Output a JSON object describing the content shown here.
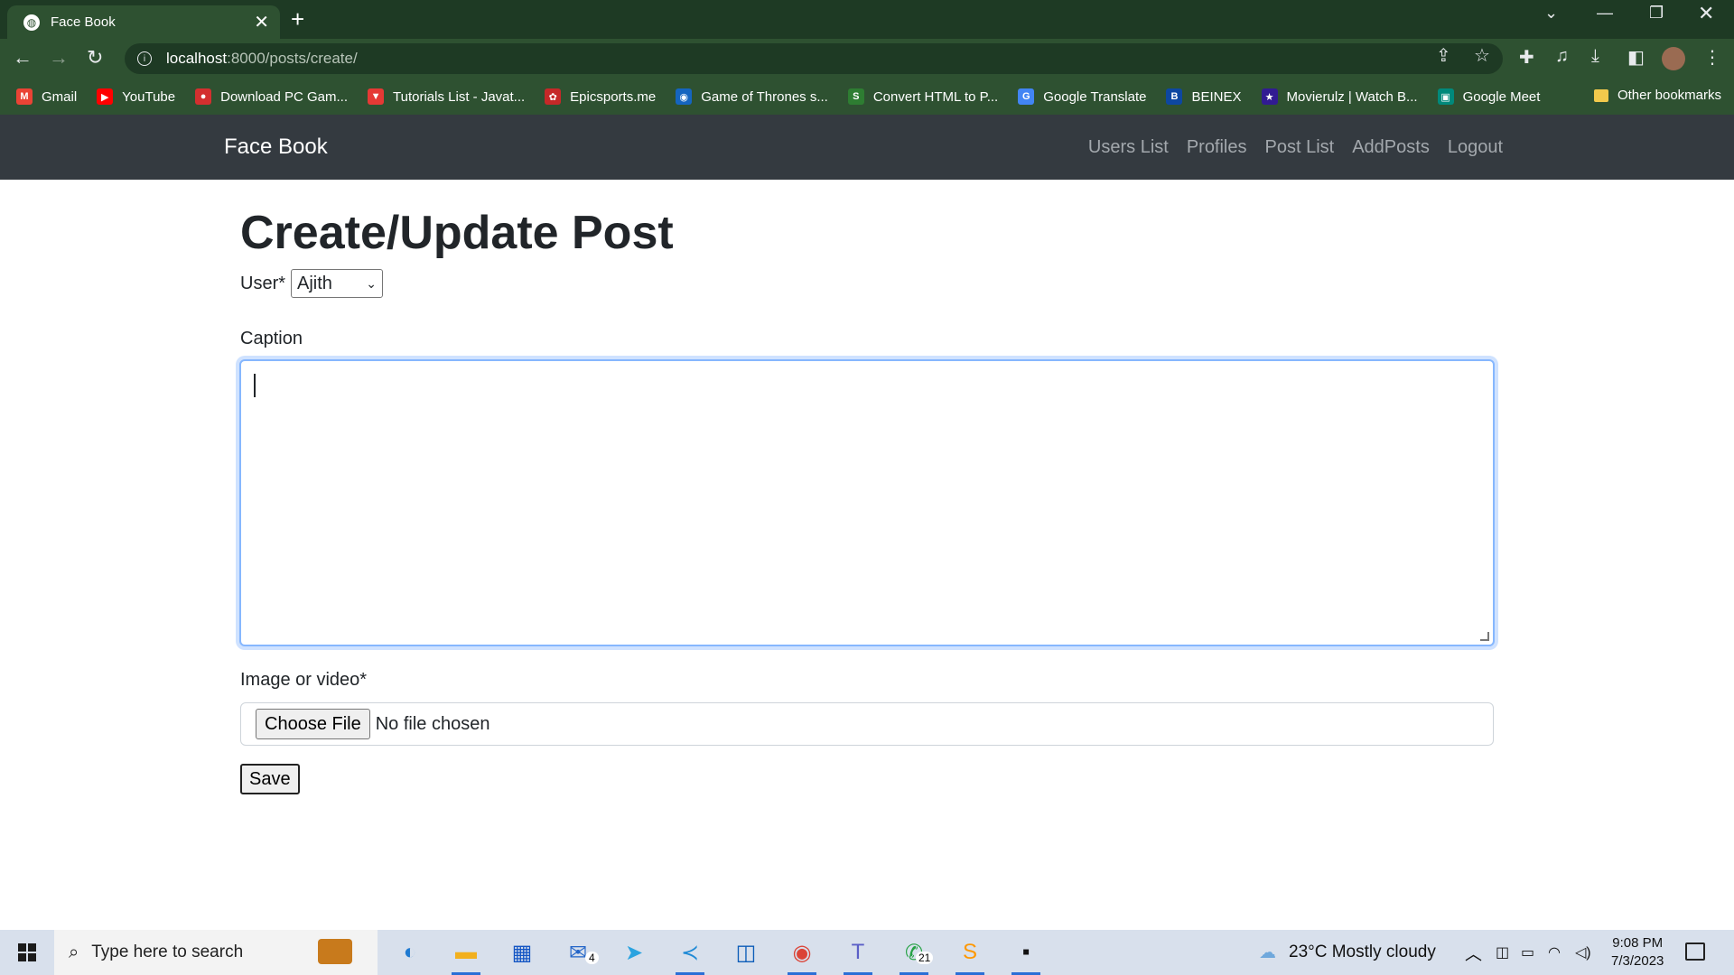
{
  "browser": {
    "tab_title": "Face Book",
    "tab_close": "✕",
    "new_tab": "+",
    "url_host": "localhost",
    "url_path": ":8000/posts/create/",
    "bookmarks": [
      {
        "label": "Gmail",
        "icon": "gmail-icon",
        "color": "#ea4335",
        "glyph": "M"
      },
      {
        "label": "YouTube",
        "icon": "youtube-icon",
        "color": "#ff0000",
        "glyph": "▶"
      },
      {
        "label": "Download PC Gam...",
        "icon": "game-icon",
        "color": "#d32f2f",
        "glyph": "●"
      },
      {
        "label": "Tutorials List - Javat...",
        "icon": "tutorial-icon",
        "color": "#e53935",
        "glyph": "▼"
      },
      {
        "label": "Epicsports.me",
        "icon": "sports-icon",
        "color": "#c62828",
        "glyph": "✿"
      },
      {
        "label": "Game of Thrones s...",
        "icon": "globe-icon",
        "color": "#1565c0",
        "glyph": "◉"
      },
      {
        "label": "Convert HTML to P...",
        "icon": "convert-icon",
        "color": "#2e7d32",
        "glyph": "S"
      },
      {
        "label": "Google Translate",
        "icon": "translate-icon",
        "color": "#4285f4",
        "glyph": "G"
      },
      {
        "label": "BEINEX",
        "icon": "beinex-icon",
        "color": "#0d47a1",
        "glyph": "B"
      },
      {
        "label": "Movierulz | Watch B...",
        "icon": "movie-icon",
        "color": "#311b92",
        "glyph": "★"
      },
      {
        "label": "Google Meet",
        "icon": "meet-icon",
        "color": "#00897b",
        "glyph": "▣"
      }
    ],
    "other_bookmarks": "Other bookmarks"
  },
  "navbar": {
    "brand": "Face Book",
    "links": [
      "Users List",
      "Profiles",
      "Post List",
      "AddPosts",
      "Logout"
    ]
  },
  "form": {
    "title": "Create/Update Post",
    "user_label": "User*",
    "user_value": "Ajith",
    "caption_label": "Caption",
    "caption_value": "",
    "file_label": "Image or video*",
    "choose_file": "Choose File",
    "no_file": "No file chosen",
    "save": "Save"
  },
  "taskbar": {
    "search_placeholder": "Type here to search",
    "weather": "23°C  Mostly cloudy",
    "time": "9:08 PM",
    "date": "7/3/2023",
    "mail_badge": "4",
    "whatsapp_badge": "21"
  },
  "colors": {
    "chrome_dark": "#1e3a24",
    "chrome_toolbar": "#2e5131",
    "navbar_bg": "#343a40",
    "focus_border": "#86b7fe"
  }
}
